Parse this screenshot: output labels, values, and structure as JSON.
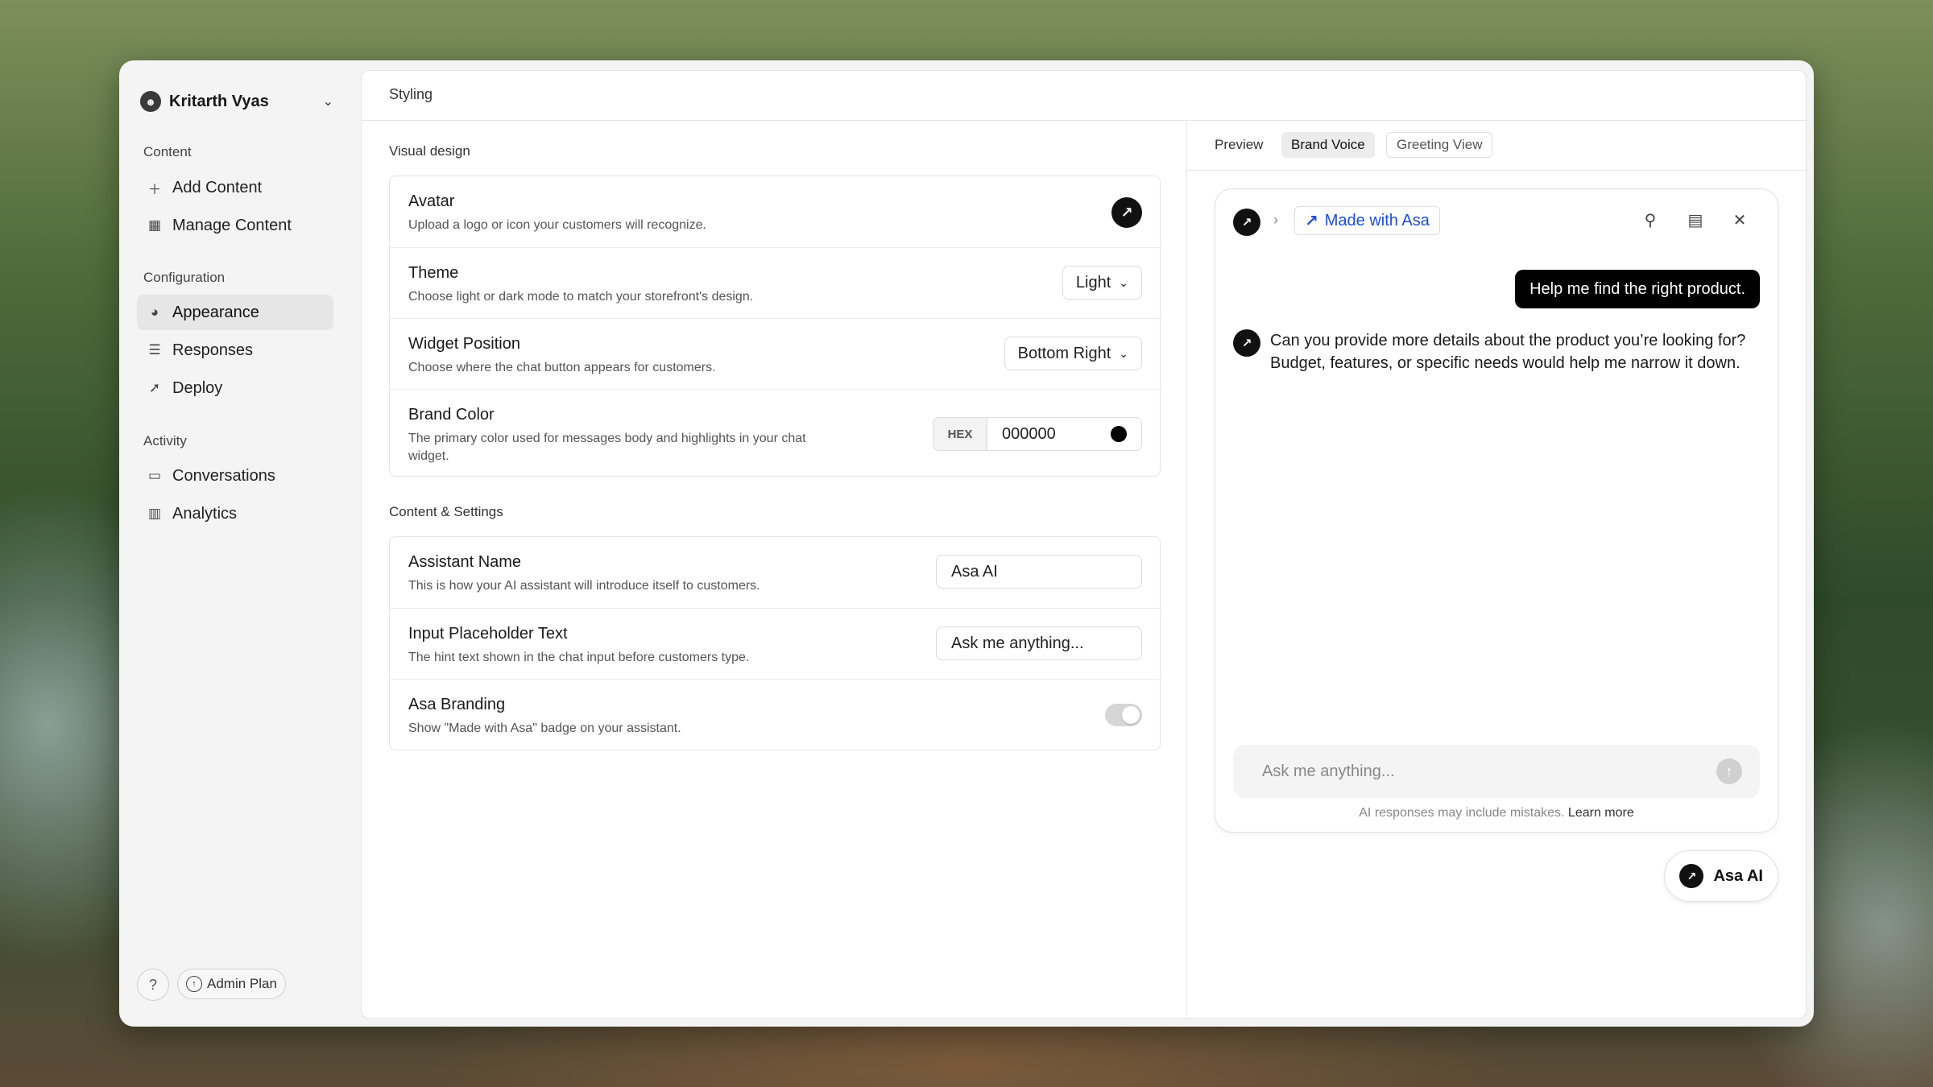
{
  "user": {
    "name": "Kritarth Vyas",
    "chevron_icon": "chevron-down-icon"
  },
  "sidebar": {
    "sections": [
      {
        "label": "Content",
        "items": [
          {
            "label": "Add Content",
            "icon": "plus-icon"
          },
          {
            "label": "Manage Content",
            "icon": "grid-icon"
          }
        ]
      },
      {
        "label": "Configuration",
        "items": [
          {
            "label": "Appearance",
            "icon": "palette-icon",
            "active": true
          },
          {
            "label": "Responses",
            "icon": "sliders-icon"
          },
          {
            "label": "Deploy",
            "icon": "rocket-icon"
          }
        ]
      },
      {
        "label": "Activity",
        "items": [
          {
            "label": "Conversations",
            "icon": "inbox-icon"
          },
          {
            "label": "Analytics",
            "icon": "bar-chart-icon"
          }
        ]
      }
    ],
    "help_label": "?",
    "plan_label": "Admin Plan"
  },
  "main": {
    "title": "Styling",
    "visual_design": {
      "label": "Visual design",
      "avatar": {
        "title": "Avatar",
        "desc": "Upload a logo or icon your customers will recognize."
      },
      "theme": {
        "title": "Theme",
        "desc": "Choose light or dark mode to match your storefront's design.",
        "value": "Light"
      },
      "position": {
        "title": "Widget Position",
        "desc": "Choose where the chat button appears for customers.",
        "value": "Bottom Right"
      },
      "brand_color": {
        "title": "Brand Color",
        "desc": "The primary color used for messages body and highlights in your chat widget.",
        "tag": "HEX",
        "value": "000000",
        "swatch": "#000000"
      }
    },
    "content_settings": {
      "label": "Content & Settings",
      "assistant_name": {
        "title": "Assistant Name",
        "desc": "This is how your AI assistant will introduce itself to customers.",
        "value": "Asa AI"
      },
      "placeholder": {
        "title": "Input Placeholder Text",
        "desc": "The hint text shown in the chat input before customers type.",
        "value": "Ask me anything..."
      },
      "branding": {
        "title": "Asa Branding",
        "desc": "Show \"Made with Asa\" badge on your assistant.",
        "enabled": true
      }
    }
  },
  "preview": {
    "label": "Preview",
    "tabs": [
      {
        "label": "Brand Voice",
        "active": true
      },
      {
        "label": "Greeting View",
        "active": false
      }
    ],
    "chat": {
      "made_with": "Made with Asa",
      "user_message": "Help me find the right product.",
      "bot_message": "Can you provide more details about the product you’re looking for? Budget, features, or specific needs would help me narrow it down.",
      "input_placeholder": "Ask me anything...",
      "disclaimer": "AI responses may include mistakes.",
      "learn_more": "Learn more"
    },
    "launcher_label": "Asa AI"
  },
  "colors": {
    "accent": "#1d4ed8",
    "brand": "#000000"
  }
}
